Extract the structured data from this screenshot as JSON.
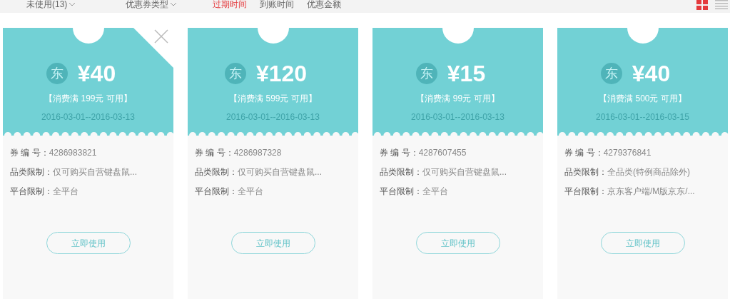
{
  "filters": [
    {
      "label": "未使用(13)"
    },
    {
      "label": "优惠券类型"
    }
  ],
  "sort_tabs": [
    {
      "label": "过期时间",
      "selected": true
    },
    {
      "label": "到账时间",
      "selected": false
    },
    {
      "label": "优惠金额",
      "selected": false
    }
  ],
  "view_toggle": [
    {
      "kind": "grid",
      "selected": true
    },
    {
      "kind": "list",
      "selected": false
    }
  ],
  "coupons": [
    {
      "closable": true,
      "badge": "东",
      "amount": "¥40",
      "condition": "【消费满 199元 可用】",
      "dates": "2016-03-01--2016-03-13",
      "fields": [
        {
          "label": "券 编 号：",
          "value": "4286983821"
        },
        {
          "label": "品类限制：",
          "value": "仅可购买自营键盘鼠..."
        },
        {
          "label": "平台限制：",
          "value": "全平台"
        }
      ],
      "button": "立即使用"
    },
    {
      "closable": false,
      "badge": "东",
      "amount": "¥120",
      "condition": "【消费满 599元 可用】",
      "dates": "2016-03-01--2016-03-13",
      "fields": [
        {
          "label": "券 编 号：",
          "value": "4286987328"
        },
        {
          "label": "品类限制：",
          "value": "仅可购买自营键盘鼠..."
        },
        {
          "label": "平台限制：",
          "value": "全平台"
        }
      ],
      "button": "立即使用"
    },
    {
      "closable": false,
      "badge": "东",
      "amount": "¥15",
      "condition": "【消费满 99元 可用】",
      "dates": "2016-03-01--2016-03-13",
      "fields": [
        {
          "label": "券 编 号：",
          "value": "4287607455"
        },
        {
          "label": "品类限制：",
          "value": "仅可购买自营键盘鼠..."
        },
        {
          "label": "平台限制：",
          "value": "全平台"
        }
      ],
      "button": "立即使用"
    },
    {
      "closable": false,
      "badge": "东",
      "amount": "¥40",
      "condition": "【消费满 500元 可用】",
      "dates": "2016-03-01--2016-03-15",
      "fields": [
        {
          "label": "券 编 号：",
          "value": "4279376841"
        },
        {
          "label": "品类限制：",
          "value": "全品类(特例商品除外)"
        },
        {
          "label": "平台限制：",
          "value": "京东客户端/M版京东/..."
        }
      ],
      "button": "立即使用"
    }
  ]
}
